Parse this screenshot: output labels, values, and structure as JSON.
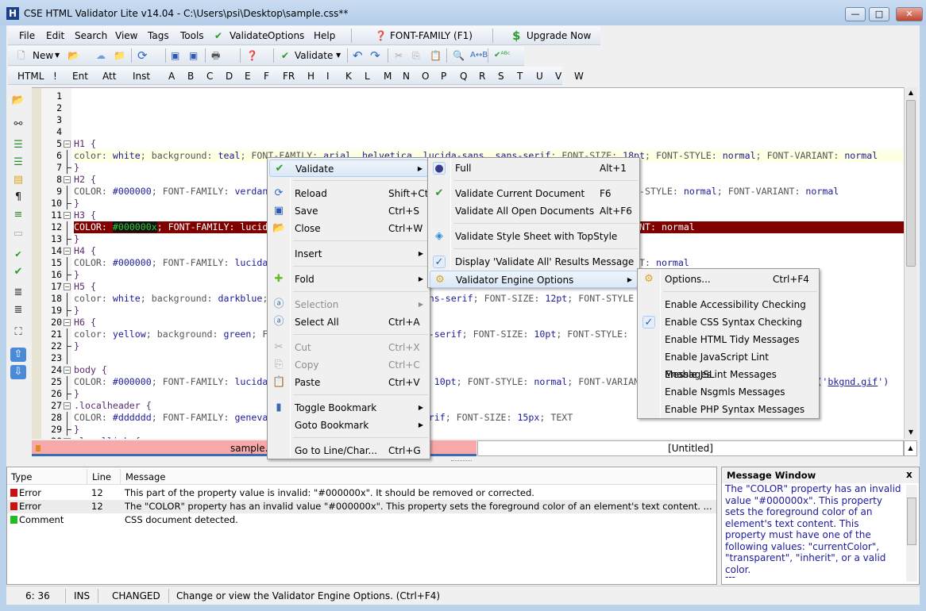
{
  "window": {
    "title": "CSE HTML Validator Lite v14.04 - C:\\Users\\psi\\Desktop\\sample.css**",
    "app_icon": "H",
    "minimize": "—",
    "maximize": "□",
    "close": "✕"
  },
  "menubar": {
    "items": [
      "File",
      "Edit",
      "Search",
      "View",
      "Tags",
      "Tools",
      "Validate",
      "Options",
      "Help"
    ],
    "help_topic": "FONT-FAMILY (F1)",
    "upgrade": "Upgrade Now"
  },
  "toolbar": {
    "new": "New",
    "validate": "Validate"
  },
  "letterbar": [
    "HTML",
    "!",
    "Ent",
    "Att",
    "Inst",
    "A",
    "B",
    "C",
    "D",
    "E",
    "F",
    "FR",
    "H",
    "I",
    "K",
    "L",
    "M",
    "N",
    "O",
    "P",
    "Q",
    "R",
    "S",
    "T",
    "U",
    "V",
    "W"
  ],
  "editor": {
    "lines": [
      "",
      "",
      "",
      "",
      "H1 {",
      "color: white; background: teal; FONT-FAMILY: arial, helvetica, lucida-sans, sans-serif; FONT-SIZE: 18pt; FONT-STYLE: normal; FONT-VARIANT: normal",
      "}",
      "H2 {",
      "COLOR: #000000; FONT-FAMILY: verdana, arial, helvetica, lucida-sans, sans-serif; FONT-SIZE: 14pt; FONT-STYLE: normal; FONT-VARIANT: normal",
      "}",
      "H3 {",
      "COLOR: #000000x; FONT-FAMILY: lucida-sans, sans-serif; FONT-SIZE: 14pt; FONT-STYLE: normal; FONT-VARIANT: normal",
      "}",
      "H4 {",
      "COLOR: #000000; FONT-FAMILY: lucida-sans, sans-serif; FONT-SIZE: 12pt; FONT-STYLE: normal; FONT-VARIANT: normal",
      "}",
      "H5 {",
      "color: white; background: darkblue; FONT-FAMILY: lucida-sans, sans-serif; FONT-SIZE: 12pt; FONT-STYLE",
      "}",
      "H6 {",
      "color: yellow; background: green; FONT-FAMILY: lucida-sans, sans-serif; FONT-SIZE: 10pt; FONT-STYLE:",
      "}",
      "",
      "body {",
      "COLOR: #000000; FONT-FAMILY: lucida-sans, sans-serif; FONT-SIZE: 10pt; FONT-STYLE: normal; FONT-VARIANT: normal; background-image: url('bkgnd.gif')",
      "}",
      ".localheader {",
      "COLOR: #dddddd; FONT-FAMILY: geneva, arial, lucida-sans, sans-serif; FONT-SIZE: 15px; TEXT",
      "}",
      ".locallink {"
    ],
    "current_line": 6,
    "error_line": 12,
    "error_token": "#000000x",
    "link_token": "bkgnd.gif",
    "tabs": [
      "sample.css",
      "[Untitled]"
    ]
  },
  "context_menu": [
    {
      "label": "Validate",
      "icon": "check",
      "submenu": true,
      "hl": true
    },
    {
      "sep": true
    },
    {
      "label": "Reload",
      "shortcut": "Shift+Ctrl+R",
      "icon": "reload"
    },
    {
      "label": "Save",
      "shortcut": "Ctrl+S",
      "icon": "save"
    },
    {
      "label": "Close",
      "shortcut": "Ctrl+W",
      "icon": "folder"
    },
    {
      "sep": true
    },
    {
      "label": "Insert",
      "submenu": true
    },
    {
      "sep": true
    },
    {
      "label": "Fold",
      "submenu": true,
      "icon": "plus"
    },
    {
      "sep": true
    },
    {
      "label": "Selection",
      "submenu": true,
      "disabled": true,
      "icon": "select"
    },
    {
      "label": "Select All",
      "shortcut": "Ctrl+A",
      "icon": "select"
    },
    {
      "sep": true
    },
    {
      "label": "Cut",
      "shortcut": "Ctrl+X",
      "disabled": true,
      "icon": "cut"
    },
    {
      "label": "Copy",
      "shortcut": "Ctrl+C",
      "disabled": true,
      "icon": "copy"
    },
    {
      "label": "Paste",
      "shortcut": "Ctrl+V",
      "icon": "paste"
    },
    {
      "sep": true
    },
    {
      "label": "Toggle Bookmark",
      "submenu": true,
      "icon": "bookmark"
    },
    {
      "label": "Goto Bookmark",
      "submenu": true
    },
    {
      "sep": true
    },
    {
      "label": "Go to Line/Char...",
      "shortcut": "Ctrl+G"
    }
  ],
  "validate_submenu": [
    {
      "label": "Full",
      "shortcut": "Alt+1",
      "icon": "radio"
    },
    {
      "sep": true
    },
    {
      "label": "Validate Current Document",
      "shortcut": "F6",
      "icon": "check"
    },
    {
      "label": "Validate All Open Documents",
      "shortcut": "Alt+F6"
    },
    {
      "sep": true
    },
    {
      "label": "Validate Style Sheet with TopStyle",
      "icon": "topstyle"
    },
    {
      "sep": true
    },
    {
      "label": "Display 'Validate All' Results Message",
      "icon": "tick"
    },
    {
      "label": "Validator Engine Options",
      "submenu": true,
      "hl": true,
      "icon": "gear"
    }
  ],
  "engine_submenu": [
    {
      "label": "Options...",
      "shortcut": "Ctrl+F4",
      "icon": "gear"
    },
    {
      "sep": true
    },
    {
      "label": "Enable Accessibility Checking"
    },
    {
      "label": "Enable CSS Syntax Checking",
      "icon": "tick"
    },
    {
      "label": "Enable HTML Tidy Messages"
    },
    {
      "label": "Enable JavaScript Lint Messages"
    },
    {
      "label": "Enable JSLint Messages"
    },
    {
      "label": "Enable Nsgmls Messages"
    },
    {
      "label": "Enable PHP Syntax Messages"
    }
  ],
  "messages": {
    "headers": [
      "Type",
      "Line",
      "Message"
    ],
    "rows": [
      {
        "type": "Error",
        "line": "12",
        "message": "This part of the property value is invalid: \"#000000x\". It should be removed or corrected.",
        "color": "#cc1111"
      },
      {
        "type": "Error",
        "line": "12",
        "message": "The \"COLOR\" property has an invalid value \"#000000x\". This property sets the foreground color of an element's text content. ...",
        "color": "#cc1111"
      },
      {
        "type": "Comment",
        "line": "",
        "message": "CSS document detected.",
        "color": "#22bb22"
      }
    ]
  },
  "message_window": {
    "title": "Message Window",
    "close": "x",
    "text": "The \"COLOR\" property has an invalid value \"#000000x\". This property sets the foreground color of an element's text content. This property must have one of the following values: \"currentColor\", \"transparent\", \"inherit\", or a valid color.",
    "more": "---"
  },
  "status": {
    "position": "6: 36",
    "mode": "INS",
    "state": "CHANGED",
    "hint": "Change or view the Validator Engine Options. (Ctrl+F4)"
  }
}
